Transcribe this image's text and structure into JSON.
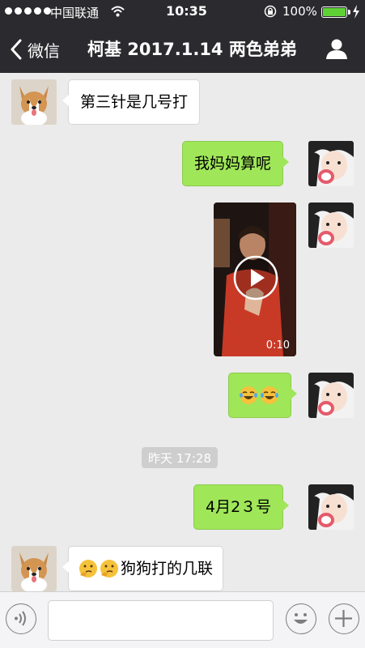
{
  "status_bar": {
    "carrier": "中国联通",
    "time": "10:35",
    "battery": "100%",
    "battery_level": 1.0
  },
  "nav": {
    "back_label": "微信",
    "title": "柯基 2017.1.14 两色弟弟"
  },
  "messages": [
    {
      "side": "left",
      "text": "第三针是几号打"
    },
    {
      "side": "right",
      "text": "我妈妈算呢"
    },
    {
      "side": "right",
      "type": "video",
      "duration": "0:10"
    },
    {
      "side": "right",
      "emoji": [
        "laughing-crying-emoji",
        "laughing-crying-emoji"
      ]
    },
    {
      "type": "timestamp",
      "text": "昨天 17:28"
    },
    {
      "side": "right",
      "text": "4月2３号"
    },
    {
      "side": "left",
      "emoji": [
        "thinking-emoji",
        "thinking-emoji"
      ],
      "text": "狗狗打的几联"
    }
  ],
  "input": {
    "value": ""
  },
  "icons": {
    "back": "chevron-left-icon",
    "profile": "person-icon",
    "voice": "voice-icon",
    "emoji": "smiley-icon",
    "more": "plus-icon"
  },
  "colors": {
    "bar_bg": "#2b2b2f",
    "chat_bg": "#ebebeb",
    "bubble_right": "#9fe659",
    "bubble_left": "#ffffff",
    "battery": "#5ed235"
  }
}
